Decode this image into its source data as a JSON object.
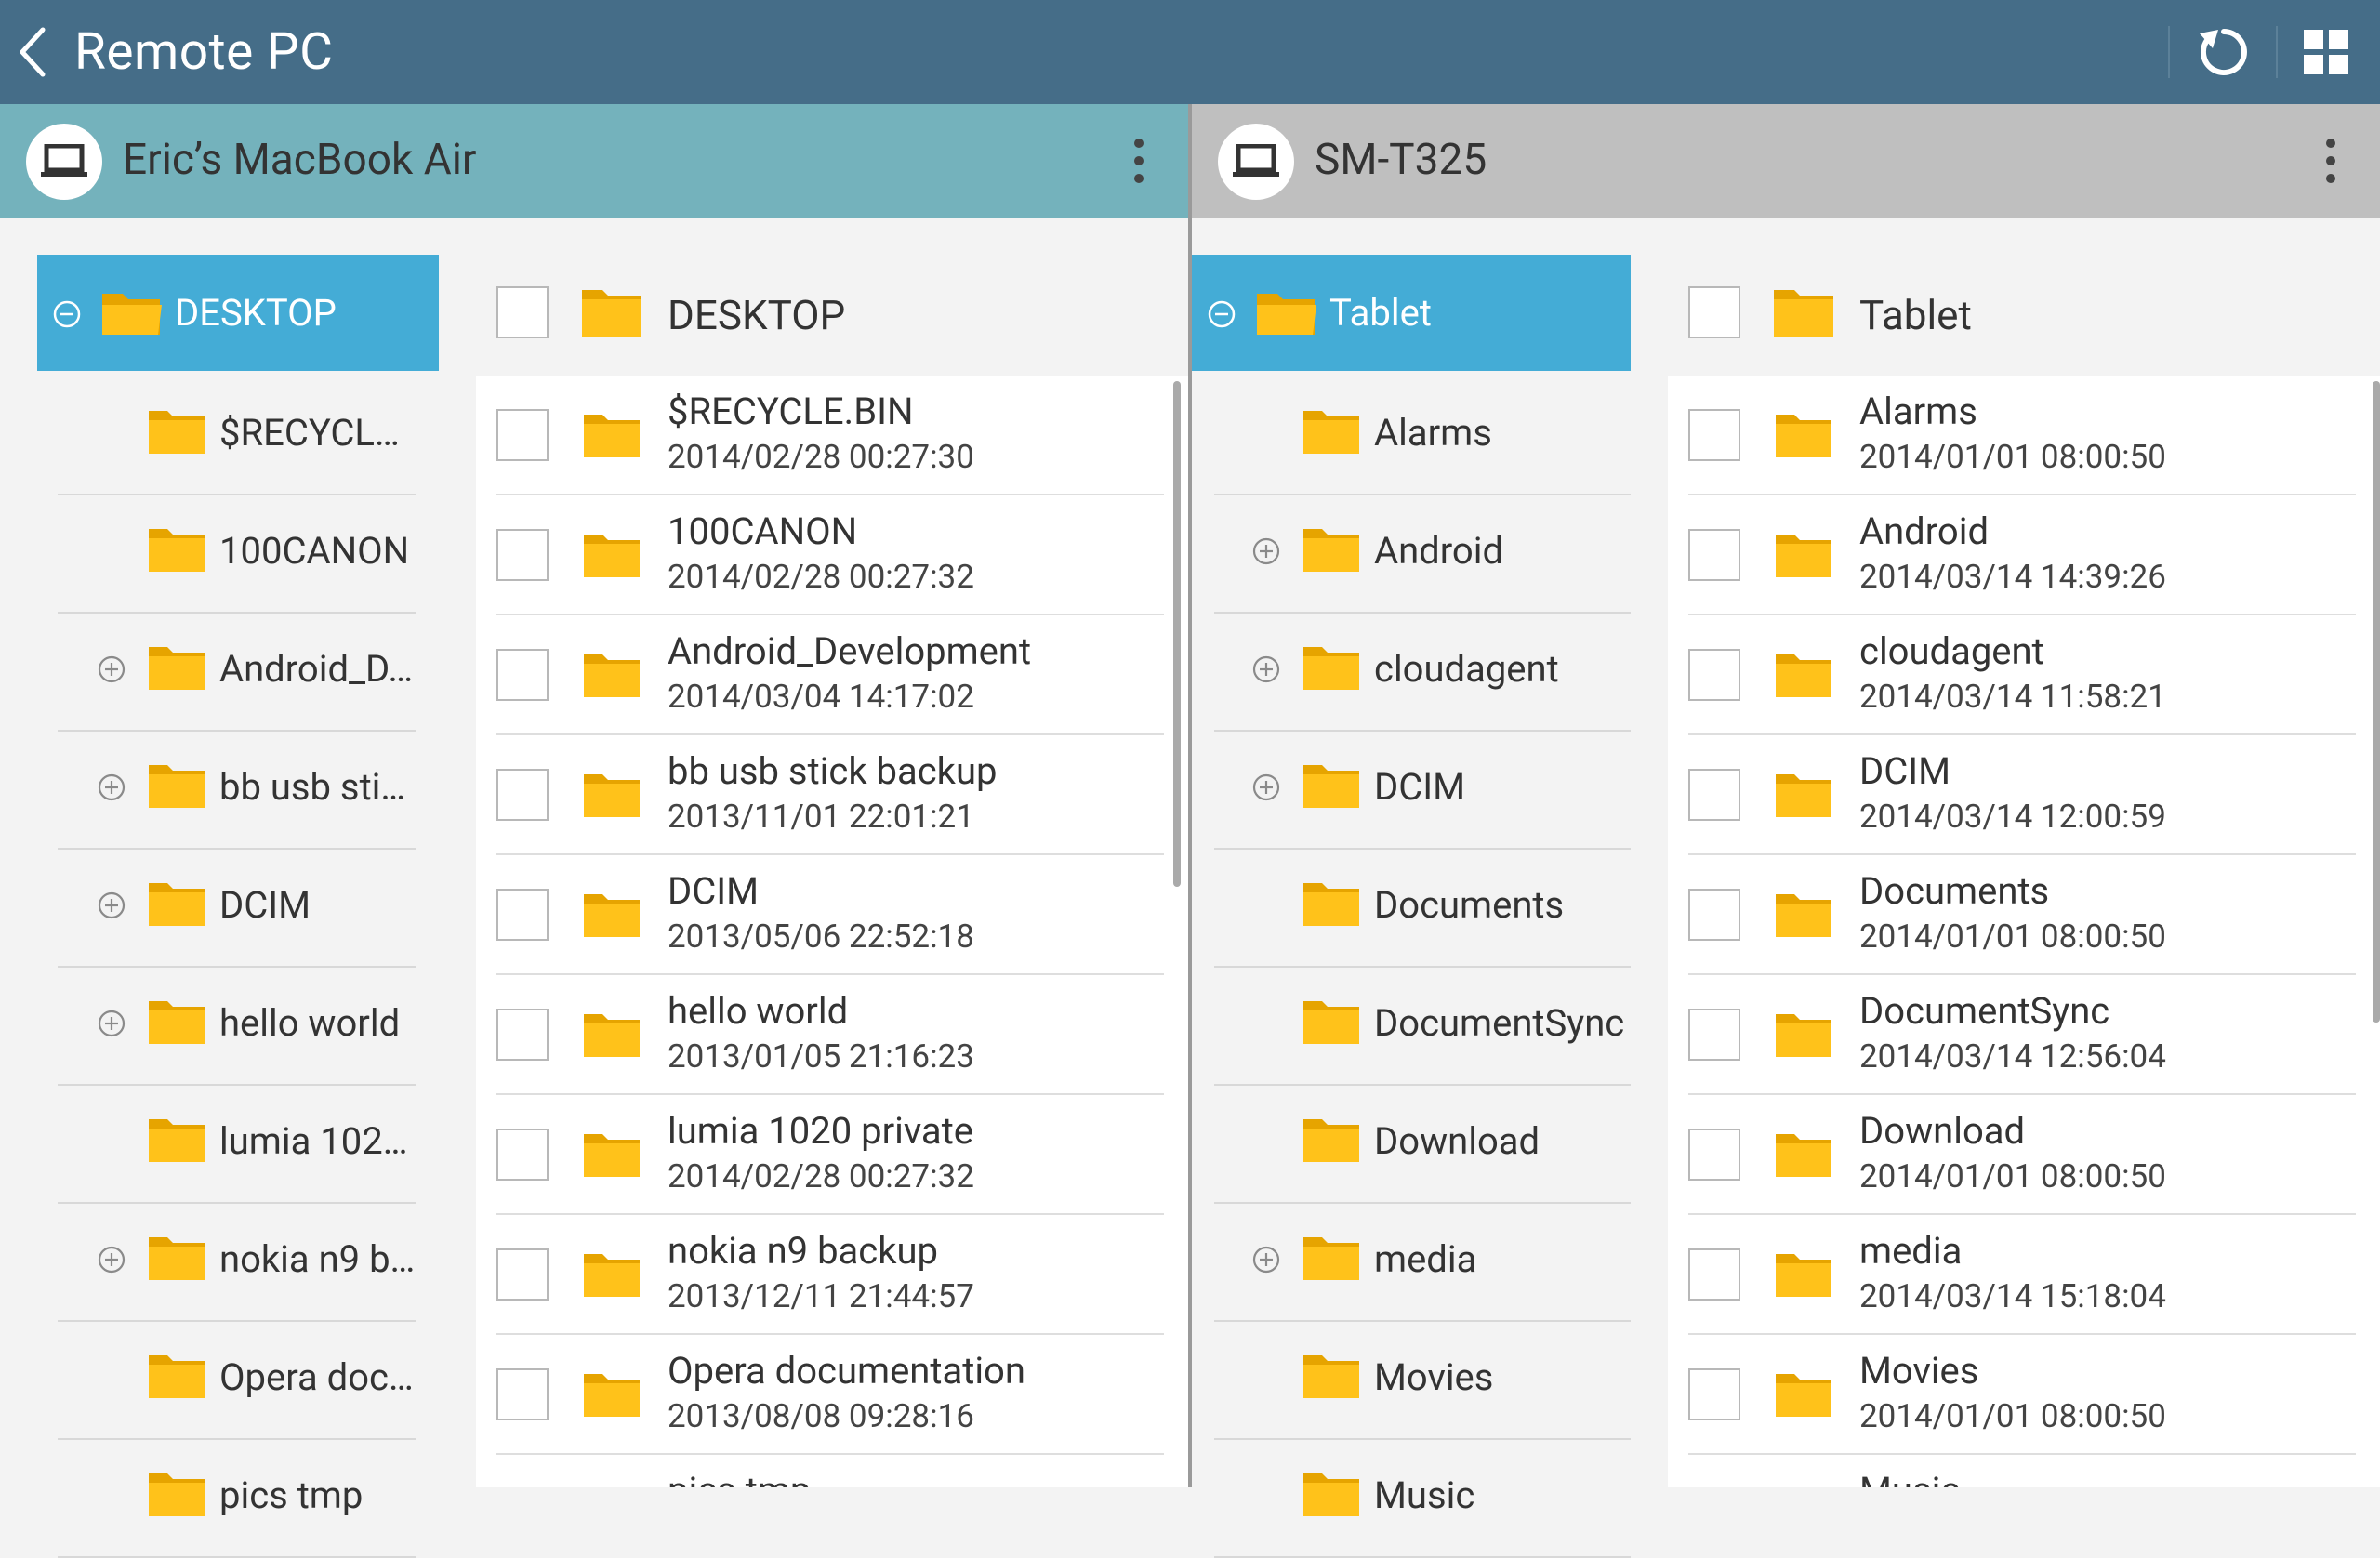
{
  "topbar": {
    "title": "Remote PC",
    "bg": "#456d88"
  },
  "left": {
    "device_name": "Eric’s MacBook Air",
    "tree_root": "DESKTOP",
    "tree_items": [
      {
        "label": "$RECYCLE...",
        "expandable": false
      },
      {
        "label": "100CANON",
        "expandable": false
      },
      {
        "label": "Android_D...",
        "expandable": true
      },
      {
        "label": "bb usb stic...",
        "expandable": true
      },
      {
        "label": "DCIM",
        "expandable": true
      },
      {
        "label": "hello world",
        "expandable": true
      },
      {
        "label": "lumia 1020...",
        "expandable": false
      },
      {
        "label": "nokia n9 b...",
        "expandable": true
      },
      {
        "label": "Opera doc...",
        "expandable": false
      },
      {
        "label": "pics tmp",
        "expandable": false
      }
    ],
    "list_head": "DESKTOP",
    "rows": [
      {
        "name": "$RECYCLE.BIN",
        "date": "2014/02/28 00:27:30"
      },
      {
        "name": "100CANON",
        "date": "2014/02/28 00:27:32"
      },
      {
        "name": "Android_Development",
        "date": "2014/03/04 14:17:02"
      },
      {
        "name": "bb usb stick backup",
        "date": "2013/11/01 22:01:21"
      },
      {
        "name": "DCIM",
        "date": "2013/05/06 22:52:18"
      },
      {
        "name": "hello world",
        "date": "2013/01/05 21:16:23"
      },
      {
        "name": "lumia 1020 private",
        "date": "2014/02/28 00:27:32"
      },
      {
        "name": "nokia n9 backup",
        "date": "2013/12/11 21:44:57"
      },
      {
        "name": "Opera documentation",
        "date": "2013/08/08 09:28:16"
      },
      {
        "name": "pics tmp",
        "date": ""
      }
    ]
  },
  "right": {
    "device_name": "SM-T325",
    "tree_root": "Tablet",
    "tree_items": [
      {
        "label": "Alarms",
        "expandable": false
      },
      {
        "label": "Android",
        "expandable": true
      },
      {
        "label": "cloudagent",
        "expandable": true
      },
      {
        "label": "DCIM",
        "expandable": true
      },
      {
        "label": "Documents",
        "expandable": false
      },
      {
        "label": "DocumentSync",
        "expandable": false
      },
      {
        "label": "Download",
        "expandable": false
      },
      {
        "label": "media",
        "expandable": true
      },
      {
        "label": "Movies",
        "expandable": false
      },
      {
        "label": "Music",
        "expandable": false
      }
    ],
    "list_head": "Tablet",
    "rows": [
      {
        "name": "Alarms",
        "date": "2014/01/01 08:00:50"
      },
      {
        "name": "Android",
        "date": "2014/03/14 14:39:26"
      },
      {
        "name": "cloudagent",
        "date": "2014/03/14 11:58:21"
      },
      {
        "name": "DCIM",
        "date": "2014/03/14 12:00:59"
      },
      {
        "name": "Documents",
        "date": "2014/01/01 08:00:50"
      },
      {
        "name": "DocumentSync",
        "date": "2014/03/14 12:56:04"
      },
      {
        "name": "Download",
        "date": "2014/01/01 08:00:50"
      },
      {
        "name": "media",
        "date": "2014/03/14 15:18:04"
      },
      {
        "name": "Movies",
        "date": "2014/01/01 08:00:50"
      },
      {
        "name": "Music",
        "date": ""
      }
    ]
  },
  "colors": {
    "accent_selected": "#44acd6",
    "left_header": "#74b2bc",
    "right_header": "#bfbfbf",
    "folder": "#f5b800"
  }
}
